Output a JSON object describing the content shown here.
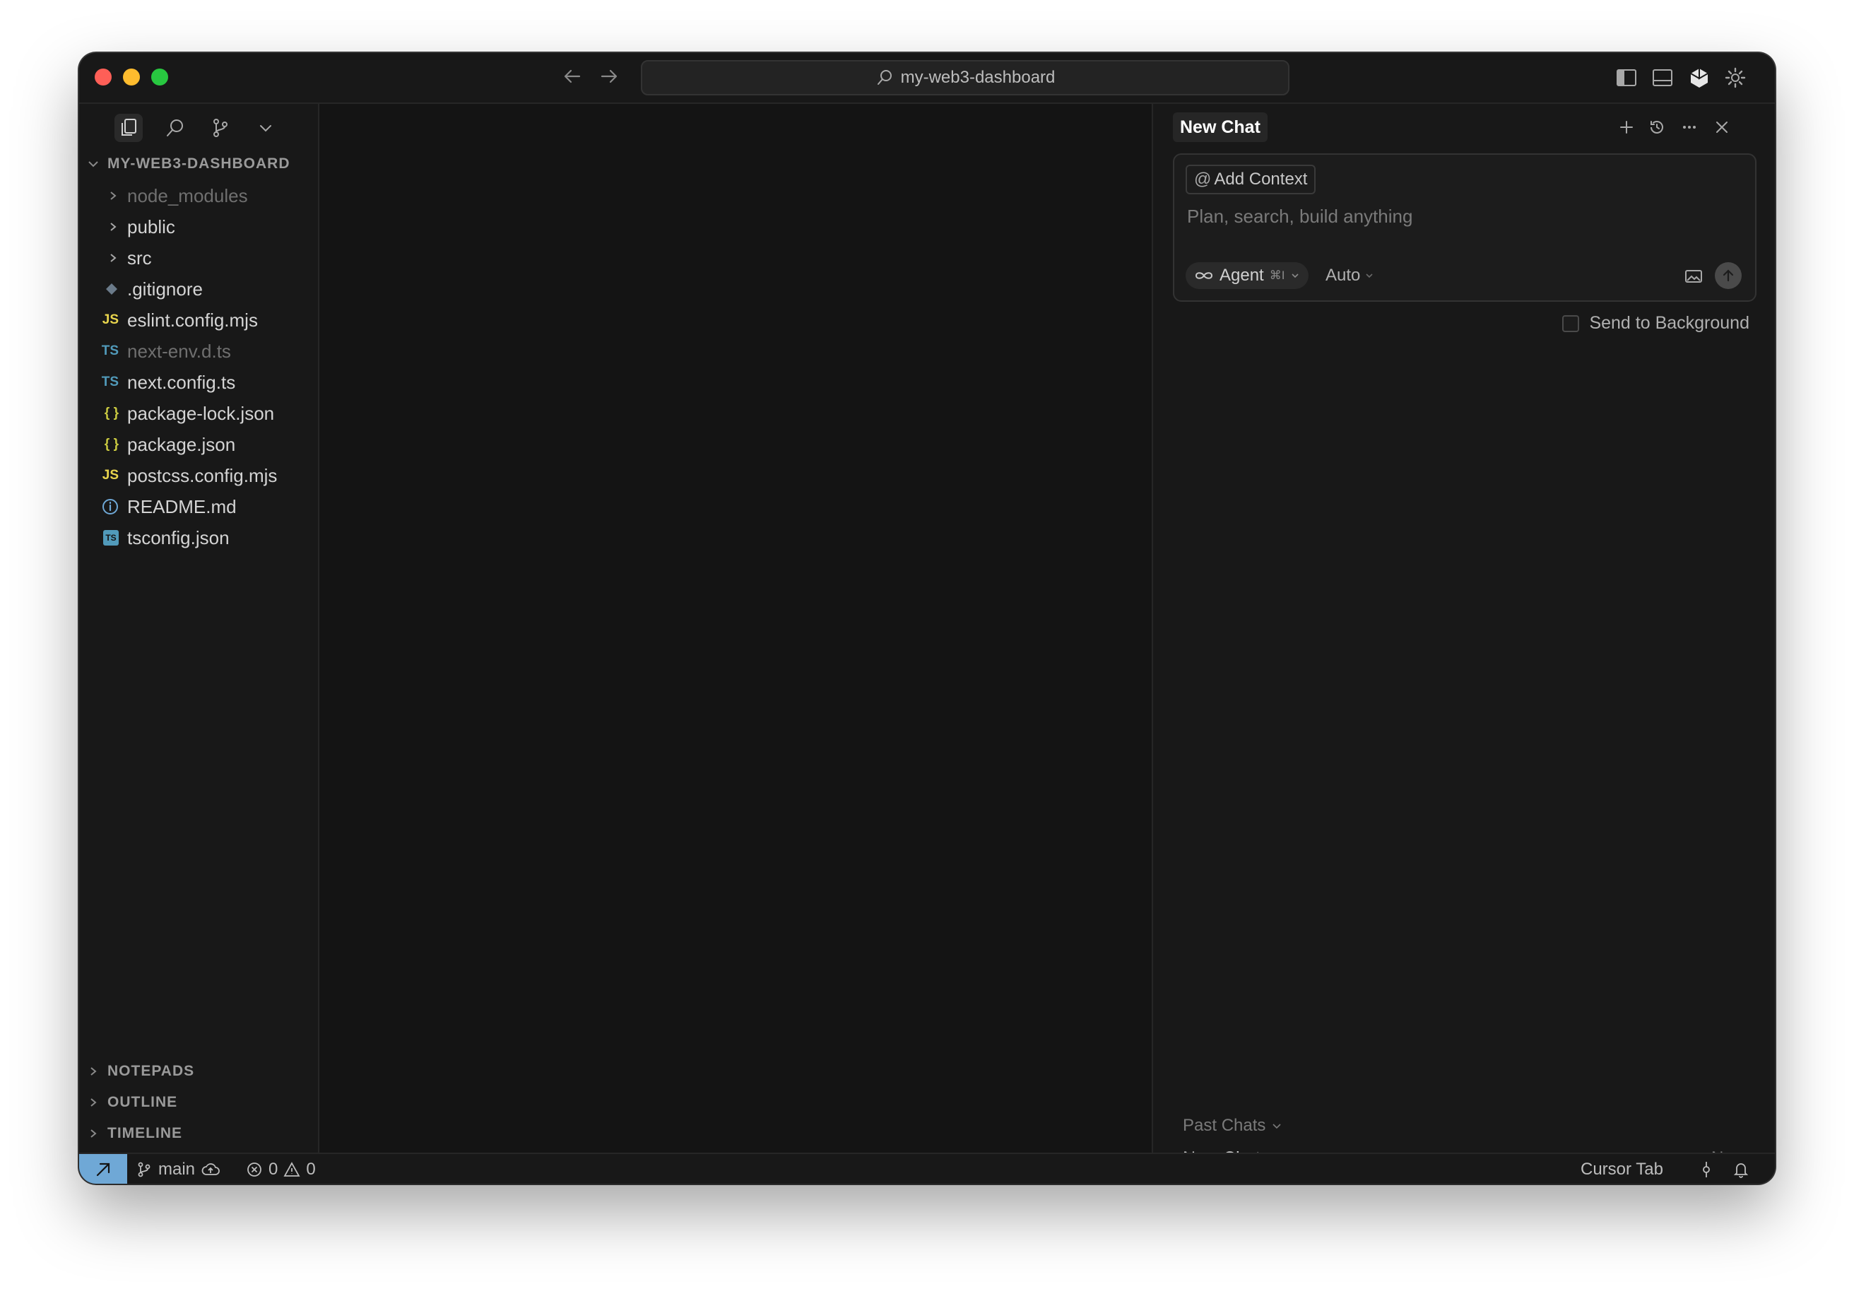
{
  "titlebar": {
    "search_text": "my-web3-dashboard"
  },
  "sidebar": {
    "project_name": "MY-WEB3-DASHBOARD",
    "files": [
      {
        "name": "node_modules",
        "type": "folder",
        "dim": true
      },
      {
        "name": "public",
        "type": "folder"
      },
      {
        "name": "src",
        "type": "folder"
      },
      {
        "name": ".gitignore",
        "type": "git"
      },
      {
        "name": "eslint.config.mjs",
        "type": "js",
        "badge": "JS"
      },
      {
        "name": "next-env.d.ts",
        "type": "ts",
        "badge": "TS",
        "dim": true
      },
      {
        "name": "next.config.ts",
        "type": "ts",
        "badge": "TS"
      },
      {
        "name": "package-lock.json",
        "type": "json",
        "badge": "{ }"
      },
      {
        "name": "package.json",
        "type": "json",
        "badge": "{ }"
      },
      {
        "name": "postcss.config.mjs",
        "type": "js",
        "badge": "JS"
      },
      {
        "name": "README.md",
        "type": "info"
      },
      {
        "name": "tsconfig.json",
        "type": "tsconfig",
        "badge": "TS"
      }
    ],
    "sections": {
      "notepads": "NOTEPADS",
      "outline": "OUTLINE",
      "timeline": "TIMELINE"
    }
  },
  "chat": {
    "tab_title": "New Chat",
    "add_context": "Add Context",
    "placeholder": "Plan, search, build anything",
    "agent_label": "Agent",
    "agent_shortcut": "⌘I",
    "model_label": "Auto",
    "send_to_background": "Send to Background",
    "past_chats_label": "Past Chats",
    "past_chats": [
      {
        "title": "New Chat",
        "time": "Now"
      }
    ]
  },
  "statusbar": {
    "branch": "main",
    "errors": "0",
    "warnings": "0",
    "cursor_tab": "Cursor Tab"
  },
  "colors": {
    "js_badge": "#e8d44d",
    "ts_badge": "#519aba",
    "json_badge": "#cbcb41",
    "remote_bg": "#6fa8d6"
  }
}
